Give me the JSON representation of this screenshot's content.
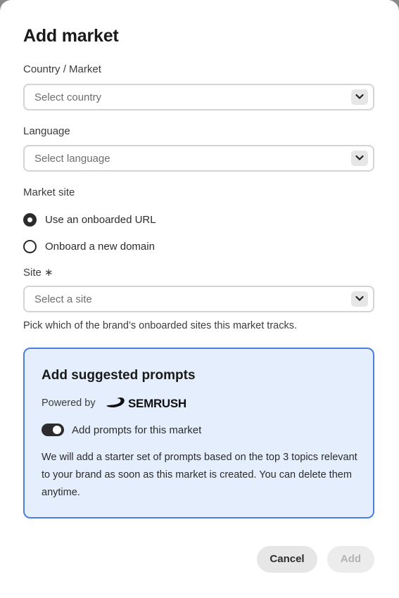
{
  "dialog": {
    "title": "Add market"
  },
  "country": {
    "label": "Country / Market",
    "placeholder": "Select country"
  },
  "language": {
    "label": "Language",
    "placeholder": "Select language"
  },
  "market_site": {
    "label": "Market site",
    "options": [
      {
        "label": "Use an onboarded URL",
        "selected": true
      },
      {
        "label": "Onboard a new domain",
        "selected": false
      }
    ]
  },
  "site": {
    "label": "Site ∗",
    "placeholder": "Select a site",
    "help": "Pick which of the brand’s onboarded sites this market tracks."
  },
  "suggested": {
    "title": "Add suggested prompts",
    "powered_by": "Powered by",
    "brand": "SEMRUSH",
    "toggle_label": "Add prompts for this market",
    "toggle_on": true,
    "description": "We will add a starter set of prompts based on the top 3 topics relevant to your brand as soon as this market is created. You can delete them anytime."
  },
  "actions": {
    "cancel": "Cancel",
    "add": "Add"
  },
  "colors": {
    "panel_bg": "#e4eefc",
    "panel_border": "#4a7fe0",
    "text_dark": "#1a1a1a",
    "control_dark": "#2c2c2c"
  },
  "icons": {
    "dropdown": "chevron-down-icon",
    "brand_logo": "semrush-logo-icon"
  }
}
